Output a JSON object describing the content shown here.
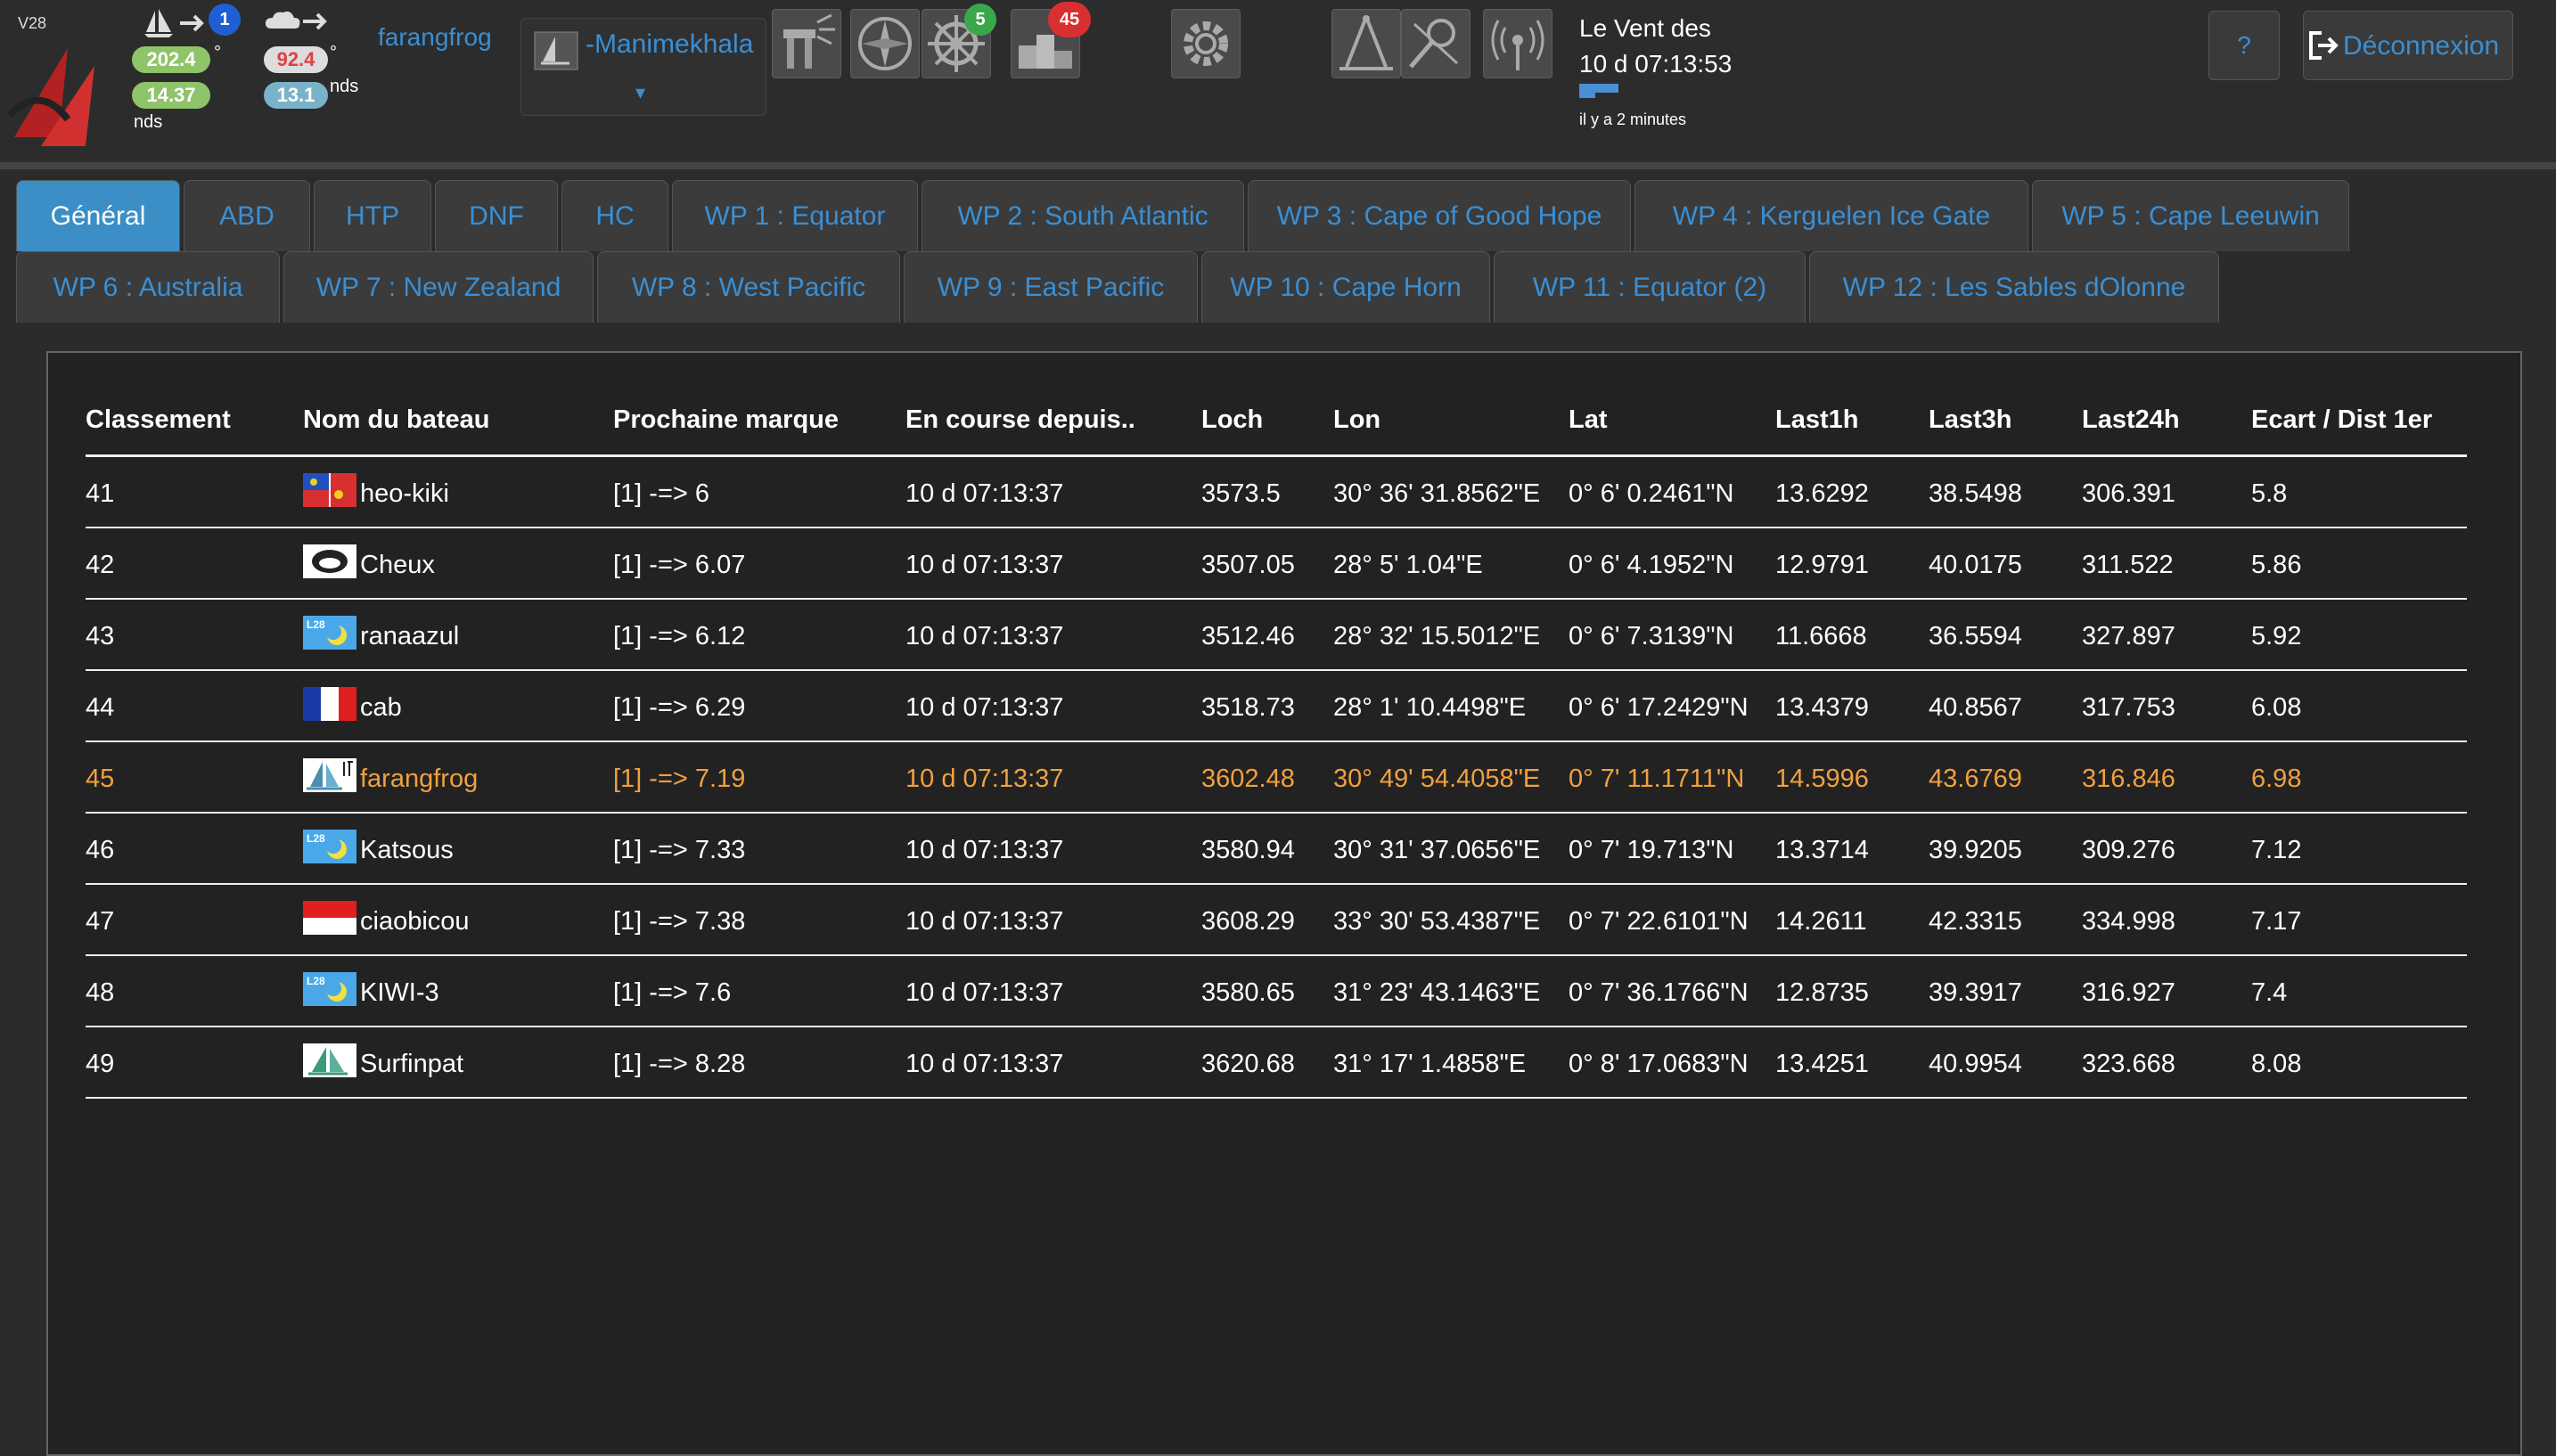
{
  "header": {
    "version": "V28",
    "boat_speed_badge": "1",
    "heading_value": "202.4",
    "heading_unit": "°",
    "speed_value": "14.37",
    "speed_unit": "nds",
    "wind_dir_value": "92.4",
    "wind_dir_unit": "°",
    "wind_speed_value": "13.1",
    "wind_speed_unit": "nds",
    "username": "farangfrog",
    "boat_select": {
      "selected": "-Manimekhala",
      "caret": "▾"
    },
    "tool_badges": {
      "rose_badge": "5",
      "podium_badge": "45"
    },
    "wind": {
      "title": "Le Vent des",
      "time": "10 d 07:13:53",
      "ago": "il y a 2 minutes"
    },
    "help_label": "?",
    "logout_label": "Déconnexion"
  },
  "tabs": {
    "row1": [
      "Général",
      "ABD",
      "HTP",
      "DNF",
      "HC",
      "WP 1 : Equator",
      "WP 2 : South Atlantic",
      "WP 3 : Cape of Good Hope",
      "WP 4 : Kerguelen Ice Gate",
      "WP 5 : Cape Leeuwin"
    ],
    "row2": [
      "WP 6 : Australia",
      "WP 7 : New Zealand",
      "WP 8 : West Pacific",
      "WP 9 : East Pacific",
      "WP 10 : Cape Horn",
      "WP 11 : Equator (2)",
      "WP 12 : Les Sables dOlonne"
    ]
  },
  "table": {
    "headers": {
      "rank": "Classement",
      "boat": "Nom du bateau",
      "next_mark": "Prochaine marque",
      "racing_since": "En course depuis..",
      "loch": "Loch",
      "lon": "Lon",
      "lat": "Lat",
      "last1h": "Last1h",
      "last3h": "Last3h",
      "last24h": "Last24h",
      "gap": "Ecart / Dist 1er"
    },
    "rows": [
      {
        "rank": "41",
        "boat": "heo-kiki",
        "flag": "multi",
        "next": "[1] -=> 6",
        "since": "10 d 07:13:37",
        "loch": "3573.5",
        "lon": "30° 36' 31.8562\"E",
        "lat": "0° 6' 0.2461\"N",
        "l1": "13.6292",
        "l3": "38.5498",
        "l24": "306.391",
        "gap": "5.8"
      },
      {
        "rank": "42",
        "boat": "Cheux",
        "flag": "logo",
        "next": "[1] -=> 6.07",
        "since": "10 d 07:13:37",
        "loch": "3507.05",
        "lon": "28° 5' 1.04\"E",
        "lat": "0° 6' 4.1952\"N",
        "l1": "12.9791",
        "l3": "40.0175",
        "l24": "311.522",
        "gap": "5.86"
      },
      {
        "rank": "43",
        "boat": "ranaazul",
        "flag": "l28",
        "next": "[1] -=> 6.12",
        "since": "10 d 07:13:37",
        "loch": "3512.46",
        "lon": "28° 32' 15.5012\"E",
        "lat": "0° 6' 7.3139\"N",
        "l1": "11.6668",
        "l3": "36.5594",
        "l24": "327.897",
        "gap": "5.92"
      },
      {
        "rank": "44",
        "boat": "cab",
        "flag": "france",
        "next": "[1] -=> 6.29",
        "since": "10 d 07:13:37",
        "loch": "3518.73",
        "lon": "28° 1' 10.4498\"E",
        "lat": "0° 6' 17.2429\"N",
        "l1": "13.4379",
        "l3": "40.8567",
        "l24": "317.753",
        "gap": "6.08"
      },
      {
        "rank": "45",
        "boat": "farangfrog",
        "flag": "sail",
        "next": "[1] -=> 7.19",
        "since": "10 d 07:13:37",
        "loch": "3602.48",
        "lon": "30° 49' 54.4058\"E",
        "lat": "0° 7' 11.1711\"N",
        "l1": "14.5996",
        "l3": "43.6769",
        "l24": "316.846",
        "gap": "6.98",
        "highlight": true
      },
      {
        "rank": "46",
        "boat": "Katsous",
        "flag": "l28",
        "next": "[1] -=> 7.33",
        "since": "10 d 07:13:37",
        "loch": "3580.94",
        "lon": "30° 31' 37.0656\"E",
        "lat": "0° 7' 19.713\"N",
        "l1": "13.3714",
        "l3": "39.9205",
        "l24": "309.276",
        "gap": "7.12"
      },
      {
        "rank": "47",
        "boat": "ciaobicou",
        "flag": "indonesia",
        "next": "[1] -=> 7.38",
        "since": "10 d 07:13:37",
        "loch": "3608.29",
        "lon": "33° 30' 53.4387\"E",
        "lat": "0° 7' 22.6101\"N",
        "l1": "14.2611",
        "l3": "42.3315",
        "l24": "334.998",
        "gap": "7.17"
      },
      {
        "rank": "48",
        "boat": "KIWI-3",
        "flag": "l28",
        "next": "[1] -=> 7.6",
        "since": "10 d 07:13:37",
        "loch": "3580.65",
        "lon": "31° 23' 43.1463\"E",
        "lat": "0° 7' 36.1766\"N",
        "l1": "12.8735",
        "l3": "39.3917",
        "l24": "316.927",
        "gap": "7.4"
      },
      {
        "rank": "49",
        "boat": "Surfinpat",
        "flag": "sail2",
        "next": "[1] -=> 8.28",
        "since": "10 d 07:13:37",
        "loch": "3620.68",
        "lon": "31° 17' 1.4858\"E",
        "lat": "0° 8' 17.0683\"N",
        "l1": "13.4251",
        "l3": "40.9954",
        "l24": "323.668",
        "gap": "8.08"
      }
    ]
  },
  "colors": {
    "accent": "#3a8fd4",
    "active_tab": "#3b8ec6",
    "highlight_row": "#f0a040",
    "green_pill": "#8fc46a",
    "teal_pill": "#7ab2c9"
  }
}
